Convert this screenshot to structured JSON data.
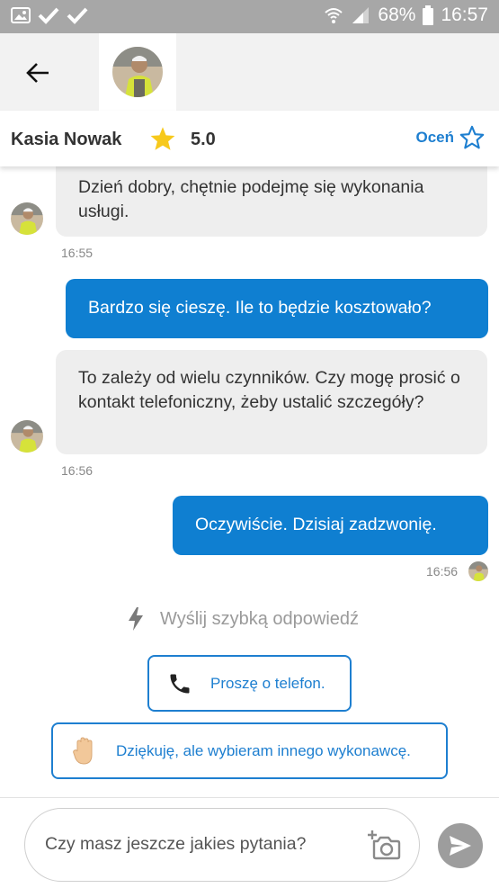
{
  "status_bar": {
    "battery": "68%",
    "time": "16:57"
  },
  "profile": {
    "name": "Kasia Nowak",
    "rating": "5.0",
    "rate_label": "Oceń"
  },
  "messages": [
    {
      "text": "Dzień dobry, chętnie podejmę się wykonania usługi.",
      "time": "16:55"
    },
    {
      "text": "Bardzo się cieszę. Ile to będzie kosztowało?"
    },
    {
      "text": "To zależy od wielu czynników. Czy mogę prosić o kontakt telefoniczny, żeby ustalić szczegóły?",
      "time": "16:56"
    },
    {
      "text": "Oczywiście. Dzisiaj zadzwonię.",
      "time": "16:56"
    }
  ],
  "quick_replies": {
    "title": "Wyślij szybką odpowiedź",
    "options": [
      "Proszę o telefon.",
      "Dziękuję, ale wybieram innego wykonawcę."
    ]
  },
  "input": {
    "placeholder": "Czy masz jeszcze jakies pytania?"
  },
  "colors": {
    "accent": "#1e7fd0",
    "outgoing_bubble": "#0f7fd1",
    "incoming_bubble": "#eeeeee",
    "star": "#f7c91c"
  },
  "icons": [
    "image-icon",
    "check-icon",
    "wifi-icon",
    "signal-icon",
    "battery-icon",
    "back-arrow-icon",
    "star-icon",
    "star-outline-icon",
    "lightning-icon",
    "phone-icon",
    "hand-icon",
    "camera-icon",
    "send-icon"
  ]
}
